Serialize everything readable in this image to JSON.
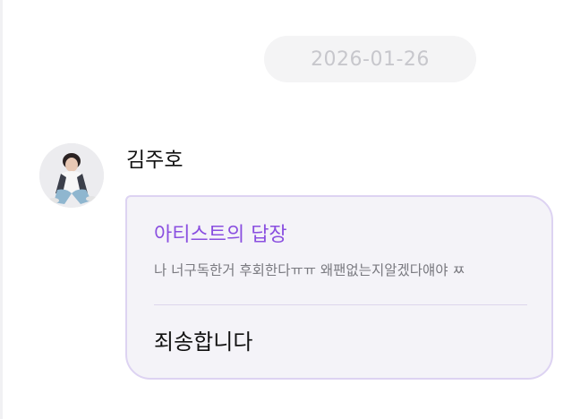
{
  "date_separator": "2026-01-26",
  "message": {
    "sender_name": "김주호",
    "avatar": "artist-profile-photo",
    "reply_card": {
      "title": "아티스트의 답장",
      "quoted_text": "나 너구독한거 후회한다ㅠㅠ 왜팬없는지알겠다얘야 ㅉ",
      "reply_text": "죄송합니다"
    }
  },
  "colors": {
    "accent": "#8a4fe0",
    "card_background": "#f4f3f8",
    "card_border": "#ddd3f2",
    "date_pill_background": "#f4f4f5"
  }
}
